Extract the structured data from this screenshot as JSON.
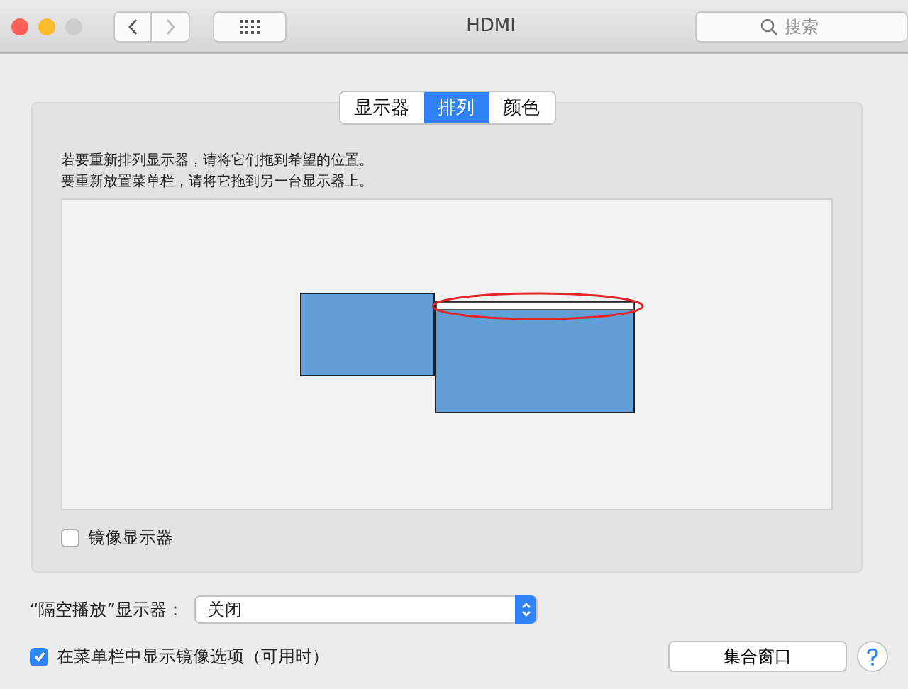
{
  "window": {
    "title": "HDMI"
  },
  "search": {
    "placeholder": "搜索"
  },
  "tabs": [
    {
      "label": "显示器",
      "selected": false
    },
    {
      "label": "排列",
      "selected": true
    },
    {
      "label": "颜色",
      "selected": false
    }
  ],
  "instructions": [
    "若要重新排列显示器，请将它们拖到希望的位置。",
    "要重新放置菜单栏，请将它拖到另一台显示器上。"
  ],
  "displays": [
    {
      "menu_bar": false
    },
    {
      "menu_bar": true
    }
  ],
  "mirror": {
    "label": "镜像显示器",
    "checked": false
  },
  "airplay": {
    "label": "“隔空播放”显示器：",
    "value": "关闭"
  },
  "show_mirroring": {
    "label": "在菜单栏中显示镜像选项（可用时）",
    "checked": true
  },
  "gather_button": "集合窗口"
}
